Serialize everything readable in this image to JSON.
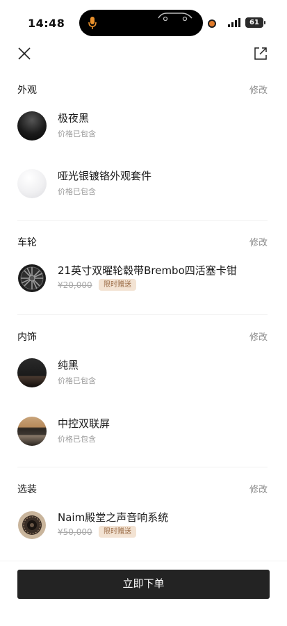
{
  "status_bar": {
    "time": "14:48",
    "battery": "61"
  },
  "sections": {
    "exterior": {
      "title": "外观",
      "edit": "修改",
      "items": [
        {
          "name": "极夜黑",
          "price_note": "价格已包含"
        },
        {
          "name": "哑光银镀铬外观套件",
          "price_note": "价格已包含"
        }
      ]
    },
    "wheels": {
      "title": "车轮",
      "edit": "修改",
      "items": [
        {
          "name": "21英寸双曜轮毂带Brembo四活塞卡钳",
          "original_price": "¥20,000",
          "badge": "限时赠送"
        }
      ]
    },
    "interior": {
      "title": "内饰",
      "edit": "修改",
      "items": [
        {
          "name": "纯黑",
          "price_note": "价格已包含"
        },
        {
          "name": "中控双联屏",
          "price_note": "价格已包含"
        }
      ]
    },
    "options": {
      "title": "选装",
      "edit": "修改",
      "items": [
        {
          "name": "Naim殿堂之声音响系统",
          "original_price": "¥50,000",
          "badge": "限时赠送"
        }
      ]
    }
  },
  "order_button": "立即下单",
  "icons": {
    "close": "close-icon",
    "share": "share-icon",
    "microphone": "microphone-icon",
    "signal": "signal-icon",
    "battery": "battery-icon"
  },
  "colors": {
    "accent_badge_bg": "#f3e3d3",
    "accent_badge_text": "#9b6c46",
    "primary_button": "#232323",
    "mic_orange": "#e8902c"
  }
}
